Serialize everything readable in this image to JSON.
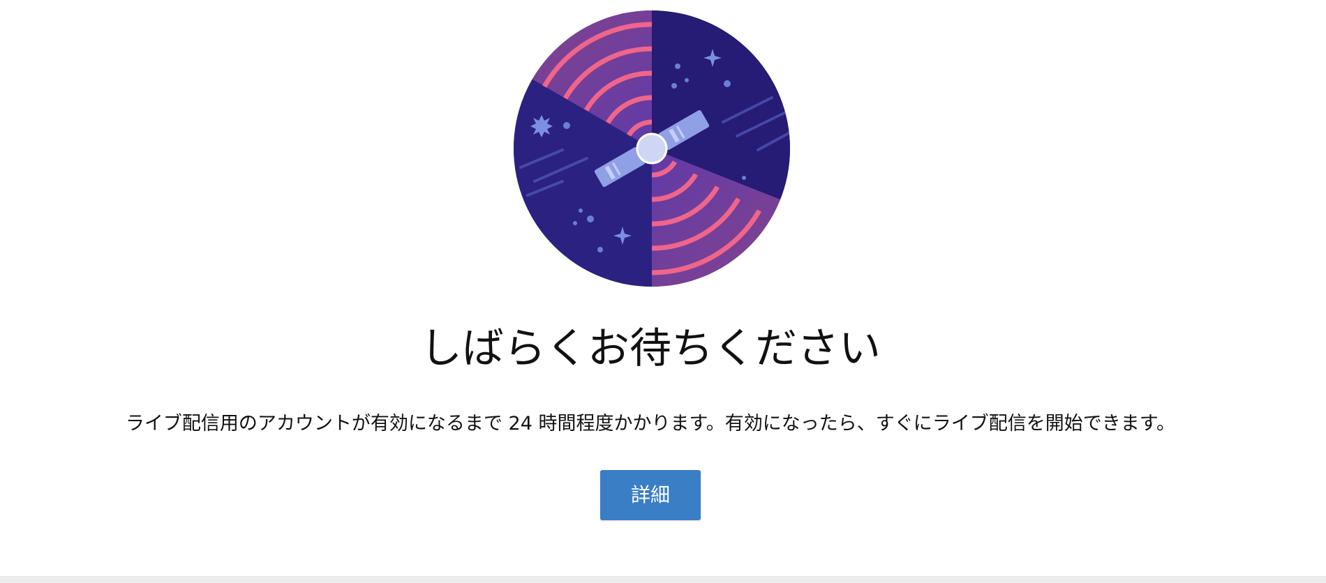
{
  "main": {
    "title": "しばらくお待ちください",
    "description": "ライブ配信用のアカウントが有効になるまで 24 時間程度かかります。有効になったら、すぐにライブ配信を開始できます。",
    "details_button_label": "詳細"
  },
  "illustration": {
    "icon": "satellite-icon",
    "colors": {
      "dark_navy": "#2a1d6e",
      "deep_purple": "#3b2c8f",
      "mauve": "#7a3f8e",
      "violet": "#6b4fc7",
      "signal_pink": "#f0658a",
      "panel_blue": "#8fa0e6"
    }
  },
  "colors": {
    "button_background": "#3a7ec6",
    "button_text": "#ffffff",
    "text": "#111111"
  }
}
